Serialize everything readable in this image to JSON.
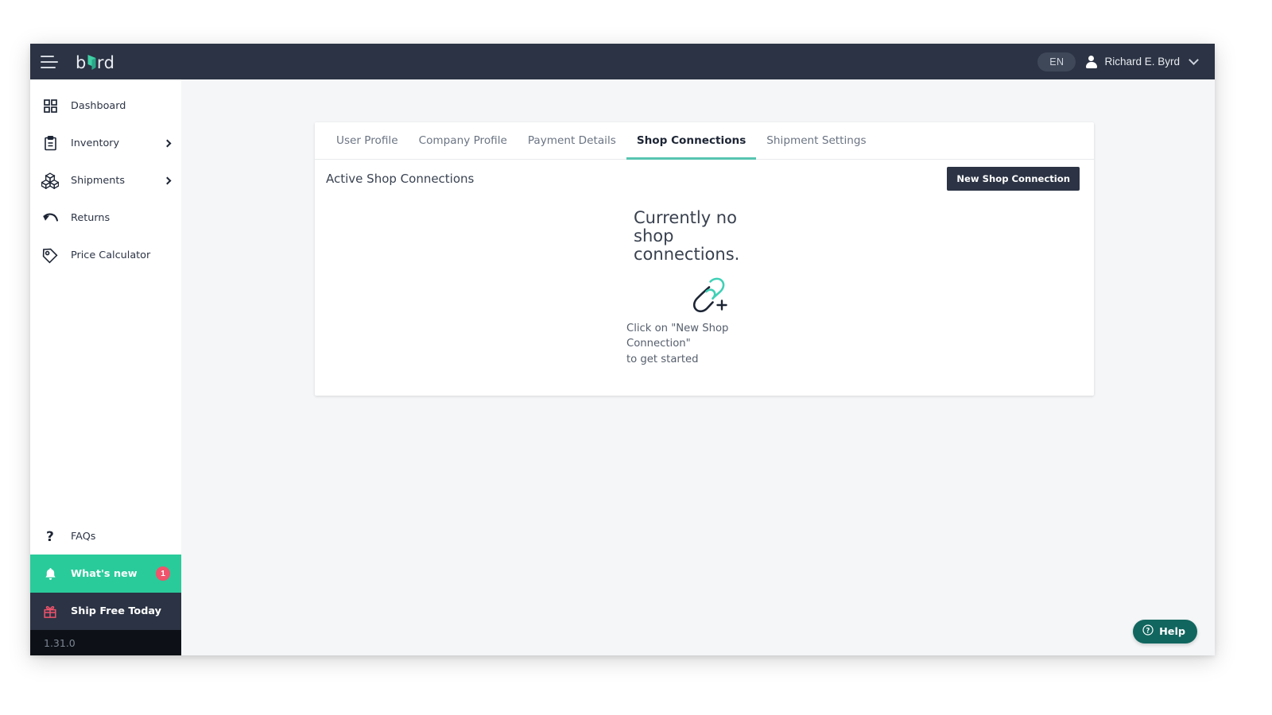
{
  "app": {
    "brand_name": "byrd",
    "version": "1.31.0"
  },
  "topbar": {
    "menu_icon": "hamburger-icon",
    "language_badge": "EN",
    "user_name": "Richard E. Byrd",
    "user_icon": "person-icon",
    "dropdown_icon": "chevron-down-icon"
  },
  "sidebar": {
    "items": [
      {
        "label": "Dashboard",
        "icon": "grid-icon",
        "has_caret": false
      },
      {
        "label": "Inventory",
        "icon": "clipboard-icon",
        "has_caret": true
      },
      {
        "label": "Shipments",
        "icon": "boxes-icon",
        "has_caret": true
      },
      {
        "label": "Returns",
        "icon": "return-arrow-icon",
        "has_caret": false
      },
      {
        "label": "Price Calculator",
        "icon": "price-tag-icon",
        "has_caret": false
      }
    ],
    "faqs": {
      "label": "FAQs",
      "icon": "question-mark-icon"
    },
    "whats_new": {
      "label": "What's new",
      "icon": "bell-icon",
      "badge": "1"
    },
    "ship_free": {
      "label": "Ship Free Today",
      "icon": "gift-icon"
    }
  },
  "tabs": [
    {
      "label": "User Profile",
      "active": false
    },
    {
      "label": "Company Profile",
      "active": false
    },
    {
      "label": "Payment Details",
      "active": false
    },
    {
      "label": "Shop Connections",
      "active": true
    },
    {
      "label": "Shipment Settings",
      "active": false
    }
  ],
  "card": {
    "title": "Active Shop Connections",
    "new_connection_button": "New Shop Connection"
  },
  "empty_state": {
    "title": "Currently no shop connections.",
    "icon": "broken-link-plus-icon",
    "subtitle_line1": "Click on \"New Shop Connection\"",
    "subtitle_line2": "to get started"
  },
  "help": {
    "label": "Help",
    "icon": "question-circle-icon"
  },
  "colors": {
    "topbar": "#2b3344",
    "accent_teal": "#29cb9a",
    "tab_underline": "#56c5b0",
    "badge_red": "#f0536b",
    "help_teal": "#11665f",
    "page_bg": "#f4f6f8"
  }
}
